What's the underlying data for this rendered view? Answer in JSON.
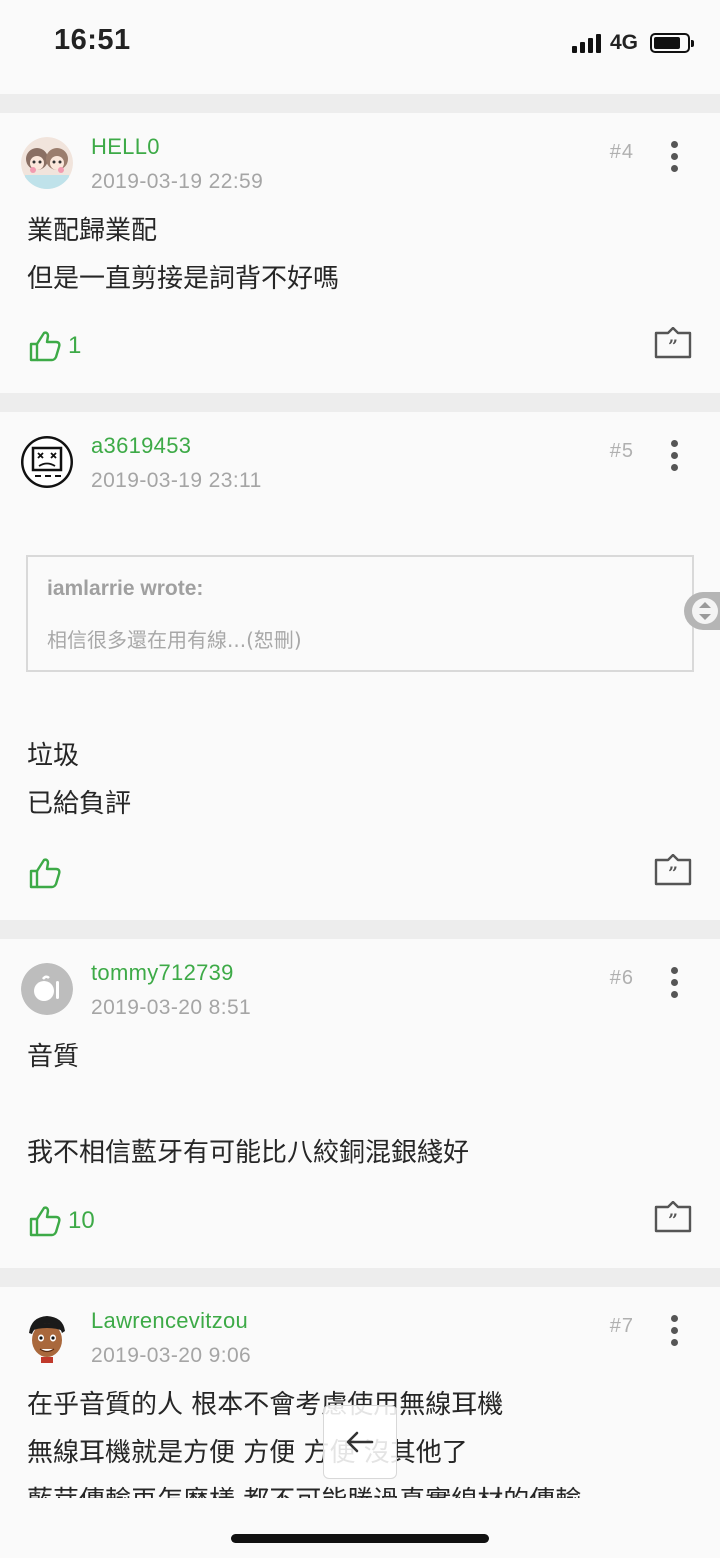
{
  "status_bar": {
    "time": "16:51",
    "network": "4G"
  },
  "posts": [
    {
      "username": "HELL0",
      "date": "2019-03-19 22:59",
      "floor": "#4",
      "lines": [
        "業配歸業配",
        "但是一直剪接是詞背不好嗎"
      ],
      "like_count": "1",
      "avatar_icon": "girl-avatar-icon"
    },
    {
      "username": "a3619453",
      "date": "2019-03-19 23:11",
      "floor": "#5",
      "quote": {
        "author": "iamlarrie wrote:",
        "text": "相信很多還在用有線...(恕刪)"
      },
      "lines": [
        "垃圾",
        "已給負評"
      ],
      "like_count": "",
      "avatar_icon": "broken-monitor-icon"
    },
    {
      "username": "tommy712739",
      "date": "2019-03-20 8:51",
      "floor": "#6",
      "lines": [
        "音質",
        "",
        "我不相信藍牙有可能比八絞銅混銀綫好"
      ],
      "like_count": "10",
      "avatar_icon": "food-plate-icon"
    },
    {
      "username": "Lawrencevitzou",
      "date": "2019-03-20 9:06",
      "floor": "#7",
      "lines": [
        "在乎音質的人 根本不會考慮使用無線耳機",
        "無線耳機就是方便 方便 方便 沒其他了",
        "藍芽傳輸再怎麼樣 都不可能勝過真實線材的傳輸"
      ],
      "avatar_icon": "cartoon-man-avatar-icon"
    }
  ],
  "colors": {
    "accent": "#3daa47",
    "muted": "#a5a5a5"
  }
}
